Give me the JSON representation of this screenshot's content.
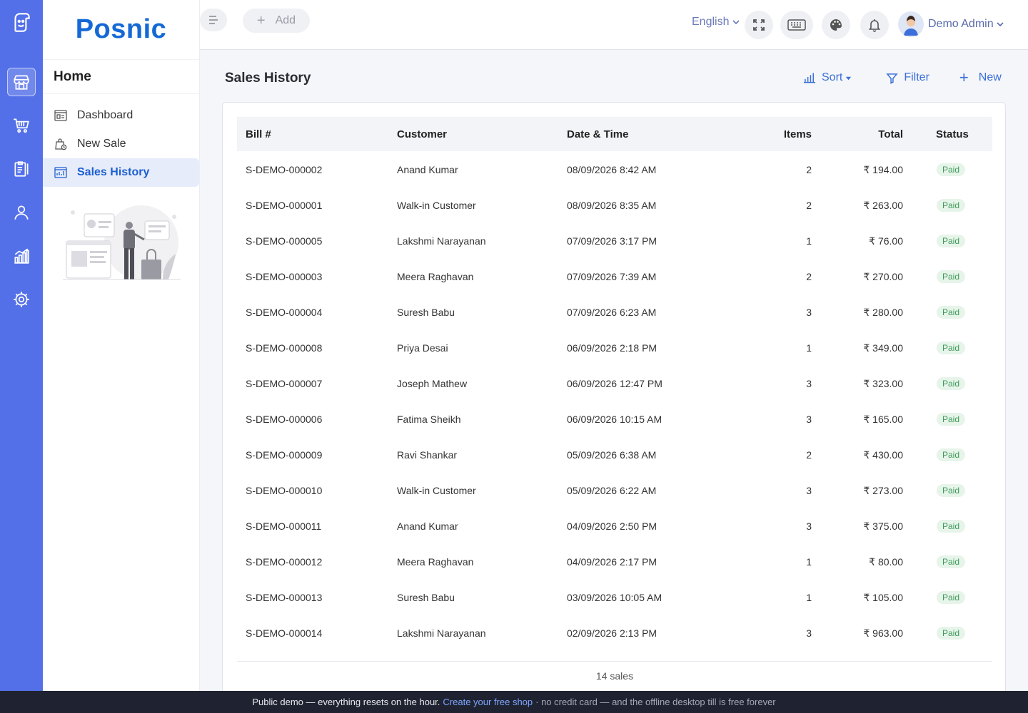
{
  "brand": "Posnic",
  "sidebar": {
    "section_title": "Home",
    "items": [
      {
        "label": "Dashboard"
      },
      {
        "label": "New Sale"
      },
      {
        "label": "Sales History"
      }
    ]
  },
  "rail": {
    "icons": [
      "app-logo-icon",
      "store-icon",
      "cart-icon",
      "clipboard-icon",
      "user-icon",
      "chart-icon",
      "gear-icon"
    ]
  },
  "topbar": {
    "add_label": "Add",
    "language": "English",
    "user_name": "Demo Admin"
  },
  "page": {
    "title": "Sales History",
    "sort_label": "Sort",
    "filter_label": "Filter",
    "new_label": "New"
  },
  "table": {
    "headers": {
      "bill": "Bill #",
      "customer": "Customer",
      "date": "Date & Time",
      "items": "Items",
      "total": "Total",
      "status": "Status"
    },
    "rows": [
      {
        "bill": "S-DEMO-000002",
        "customer": "Anand Kumar",
        "date": "08/09/2026 8:42 AM",
        "items": "2",
        "total": "₹ 194.00",
        "status": "Paid"
      },
      {
        "bill": "S-DEMO-000001",
        "customer": "Walk-in Customer",
        "date": "08/09/2026 8:35 AM",
        "items": "2",
        "total": "₹ 263.00",
        "status": "Paid"
      },
      {
        "bill": "S-DEMO-000005",
        "customer": "Lakshmi Narayanan",
        "date": "07/09/2026 3:17 PM",
        "items": "1",
        "total": "₹ 76.00",
        "status": "Paid"
      },
      {
        "bill": "S-DEMO-000003",
        "customer": "Meera Raghavan",
        "date": "07/09/2026 7:39 AM",
        "items": "2",
        "total": "₹ 270.00",
        "status": "Paid"
      },
      {
        "bill": "S-DEMO-000004",
        "customer": "Suresh Babu",
        "date": "07/09/2026 6:23 AM",
        "items": "3",
        "total": "₹ 280.00",
        "status": "Paid"
      },
      {
        "bill": "S-DEMO-000008",
        "customer": "Priya Desai",
        "date": "06/09/2026 2:18 PM",
        "items": "1",
        "total": "₹ 349.00",
        "status": "Paid"
      },
      {
        "bill": "S-DEMO-000007",
        "customer": "Joseph Mathew",
        "date": "06/09/2026 12:47 PM",
        "items": "3",
        "total": "₹ 323.00",
        "status": "Paid"
      },
      {
        "bill": "S-DEMO-000006",
        "customer": "Fatima Sheikh",
        "date": "06/09/2026 10:15 AM",
        "items": "3",
        "total": "₹ 165.00",
        "status": "Paid"
      },
      {
        "bill": "S-DEMO-000009",
        "customer": "Ravi Shankar",
        "date": "05/09/2026 6:38 AM",
        "items": "2",
        "total": "₹ 430.00",
        "status": "Paid"
      },
      {
        "bill": "S-DEMO-000010",
        "customer": "Walk-in Customer",
        "date": "05/09/2026 6:22 AM",
        "items": "3",
        "total": "₹ 273.00",
        "status": "Paid"
      },
      {
        "bill": "S-DEMO-000011",
        "customer": "Anand Kumar",
        "date": "04/09/2026 2:50 PM",
        "items": "3",
        "total": "₹ 375.00",
        "status": "Paid"
      },
      {
        "bill": "S-DEMO-000012",
        "customer": "Meera Raghavan",
        "date": "04/09/2026 2:17 PM",
        "items": "1",
        "total": "₹ 80.00",
        "status": "Paid"
      },
      {
        "bill": "S-DEMO-000013",
        "customer": "Suresh Babu",
        "date": "03/09/2026 10:05 AM",
        "items": "1",
        "total": "₹ 105.00",
        "status": "Paid"
      },
      {
        "bill": "S-DEMO-000014",
        "customer": "Lakshmi Narayanan",
        "date": "02/09/2026 2:13 PM",
        "items": "3",
        "total": "₹ 963.00",
        "status": "Paid"
      }
    ],
    "footer": "14 sales"
  },
  "banner": {
    "text_start": "Public demo — everything resets on the hour.",
    "link": "Create your free shop",
    "text_end": "· no credit card — and the offline desktop till is free forever"
  },
  "colors": {
    "rail": "#5470e8",
    "brand": "#1569d6",
    "accent": "#3a6fd8",
    "paid_badge_bg": "#e6f4ea",
    "paid_badge_text": "#3f9b5a",
    "banner_bg": "#1f2331"
  }
}
